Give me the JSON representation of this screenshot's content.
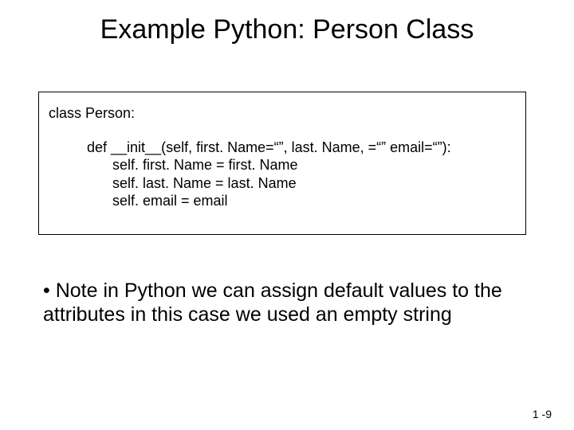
{
  "title": "Example Python: Person Class",
  "code": {
    "l1": "class Person:",
    "l2": "def __init__(self, first. Name=“”, last. Name, =“” email=“”):",
    "l3": "self. first. Name = first. Name",
    "l4": "self. last. Name = last. Name",
    "l5": "self. email = email"
  },
  "note": "• Note in Python we can assign default values to the attributes in this case we used an empty string",
  "page_number": "1 -9"
}
